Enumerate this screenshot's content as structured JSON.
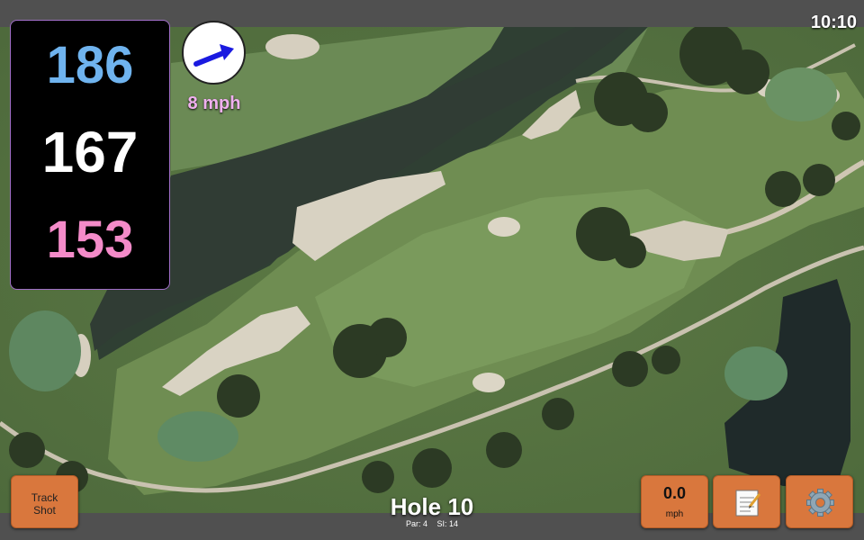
{
  "status": {
    "time": "10:10"
  },
  "yardages": {
    "back": "186",
    "middle": "167",
    "front": "153"
  },
  "wind": {
    "speed_label": "8 mph",
    "arrow_icon": "wind-arrow-icon"
  },
  "hole": {
    "title": "Hole 10",
    "par": "Par: 4",
    "stroke_index": "SI: 14"
  },
  "buttons": {
    "track_line1": "Track",
    "track_line2": "Shot",
    "speed_value": "0.0",
    "speed_unit": "mph",
    "notes_icon": "notepad-icon",
    "settings_icon": "gear-icon"
  },
  "colors": {
    "back_yardage": "#6fb3ee",
    "middle_yardage": "#ffffff",
    "front_yardage": "#f48bc9",
    "button_accent": "#d9773d",
    "wind_text": "#f0b0ef"
  }
}
